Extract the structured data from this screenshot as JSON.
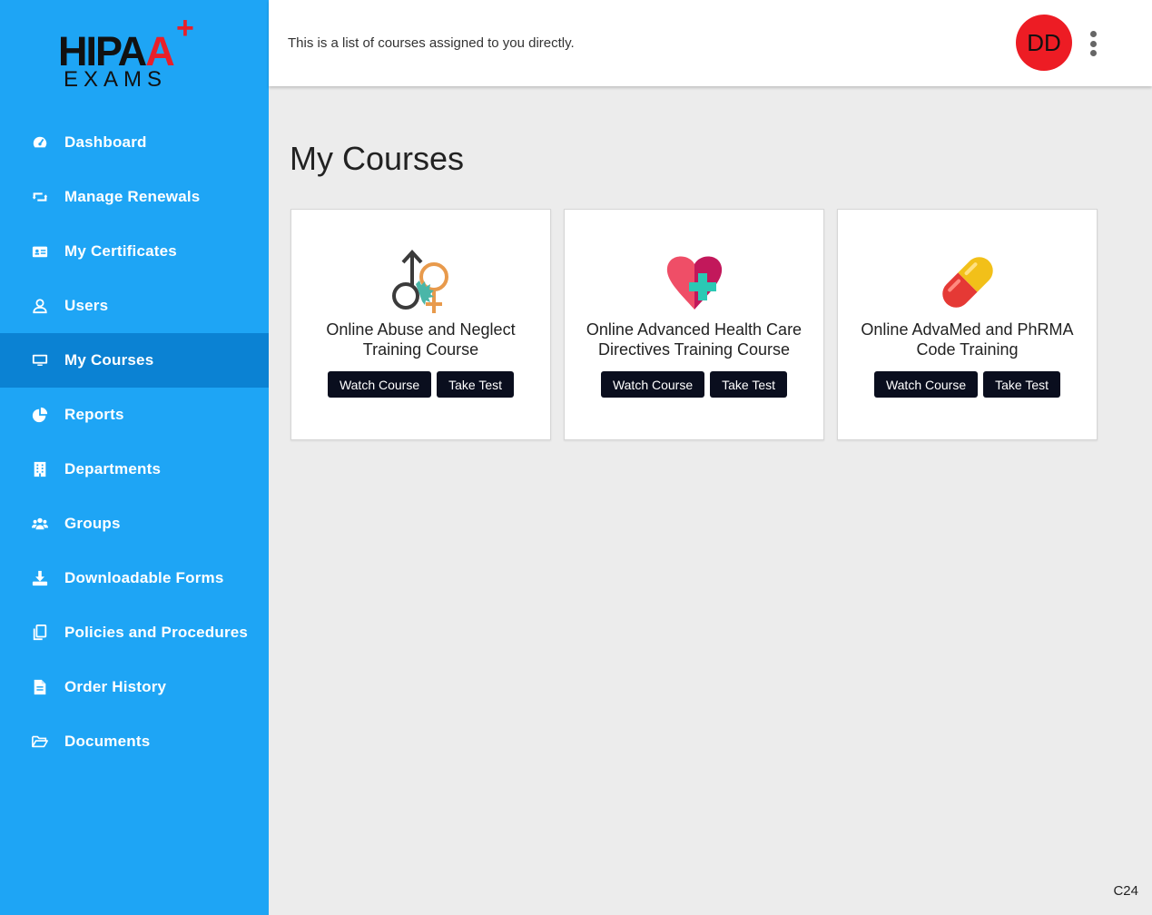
{
  "brand": {
    "logo_text_1": "HIPAA",
    "logo_plus": "+",
    "logo_text_2": "EXAMS",
    "accent": "#1ea5f5",
    "active": "#0b82d3",
    "red": "#e8202a"
  },
  "sidebar": {
    "items": [
      {
        "label": "Dashboard",
        "icon": "dashboard-icon"
      },
      {
        "label": "Manage Renewals",
        "icon": "retweet-icon"
      },
      {
        "label": "My Certificates",
        "icon": "id-card-icon"
      },
      {
        "label": "Users",
        "icon": "user-icon"
      },
      {
        "label": "My Courses",
        "icon": "monitor-icon",
        "active": true
      },
      {
        "label": "Reports",
        "icon": "pie-chart-icon"
      },
      {
        "label": "Departments",
        "icon": "building-icon"
      },
      {
        "label": "Groups",
        "icon": "users-icon"
      },
      {
        "label": "Downloadable Forms",
        "icon": "download-icon"
      },
      {
        "label": "Policies and Procedures",
        "icon": "copy-icon"
      },
      {
        "label": "Order History",
        "icon": "file-icon"
      },
      {
        "label": "Documents",
        "icon": "folder-open-icon"
      }
    ]
  },
  "header": {
    "subtitle": "This is a list of courses assigned to you directly.",
    "avatar_initials": "DD"
  },
  "main": {
    "title": "My Courses",
    "courses": [
      {
        "title": "Online Abuse and Neglect Training Course",
        "icon": "gender-symbols-icon",
        "watch_label": "Watch Course",
        "test_label": "Take Test"
      },
      {
        "title": "Online Advanced Health Care Directives Training Course",
        "icon": "heart-cross-icon",
        "watch_label": "Watch Course",
        "test_label": "Take Test"
      },
      {
        "title": "Online AdvaMed and PhRMA Code Training",
        "icon": "pill-capsule-icon",
        "watch_label": "Watch Course",
        "test_label": "Take Test"
      }
    ]
  },
  "footer": {
    "version": "C24"
  }
}
